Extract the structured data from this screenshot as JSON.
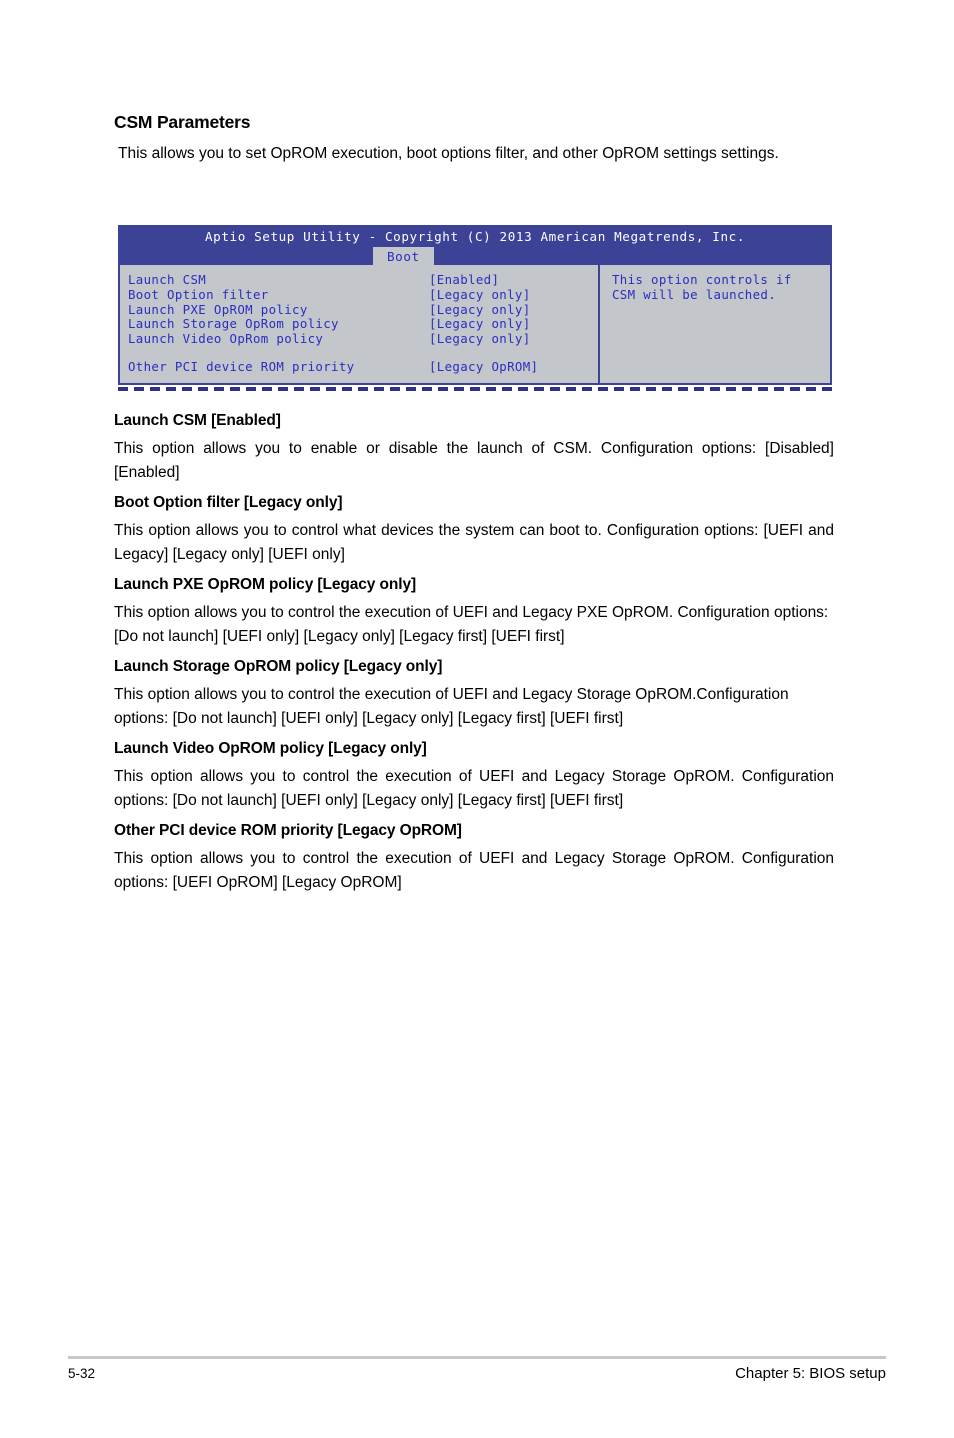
{
  "document": {
    "section_title": "CSM Parameters",
    "intro": "This allows you to set OpROM execution, boot options filter, and other OpROM settings settings.",
    "items": [
      {
        "title": "Launch CSM [Enabled]",
        "description": "This option allows you to enable or disable the launch of CSM. Configuration options: [Disabled] [Enabled]"
      },
      {
        "title": "Boot Option filter [Legacy only]",
        "description": "This option allows you to control what devices the system can boot to. Configuration options: [UEFI and Legacy] [Legacy only] [UEFI only]"
      },
      {
        "title": "Launch PXE OpROM policy [Legacy only]",
        "description": "This option allows you to control the execution of UEFI and Legacy PXE OpROM. Configuration options: [Do not launch] [UEFI only] [Legacy only] [Legacy first] [UEFI first]"
      },
      {
        "title": "Launch Storage OpROM policy [Legacy only]",
        "description": "This option allows you to control the execution of UEFI and Legacy Storage OpROM.Configuration options: [Do not launch] [UEFI only] [Legacy only] [Legacy first] [UEFI first]"
      },
      {
        "title": "Launch Video OpROM policy [Legacy only]",
        "description": "This option allows you to control the execution of UEFI and Legacy Storage OpROM. Configuration options: [Do not launch] [UEFI only] [Legacy only] [Legacy first] [UEFI first]"
      },
      {
        "title": "Other PCI device ROM priority [Legacy OpROM]",
        "description": "This option allows you to control the execution of UEFI and Legacy Storage OpROM. Configuration options: [UEFI OpROM] [Legacy OpROM]"
      }
    ]
  },
  "bios": {
    "title": "Aptio Setup Utility - Copyright (C) 2013 American Megatrends, Inc.",
    "active_tab": "Boot",
    "settings": [
      {
        "label": "Launch CSM",
        "value": "[Enabled]"
      },
      {
        "label": "Boot Option filter",
        "value": "[Legacy only]"
      },
      {
        "label": "Launch PXE OpROM policy",
        "value": "[Legacy only]"
      },
      {
        "label": "Launch Storage OpRom policy",
        "value": "[Legacy only]"
      },
      {
        "label": "Launch Video OpRom policy",
        "value": "[Legacy only]"
      },
      {
        "label": "Other PCI device ROM priority",
        "value": "[Legacy OpROM]"
      }
    ],
    "help": {
      "line1": "This option controls if",
      "line2": "CSM will be launched."
    },
    "colors": {
      "header_blue": "#3c4296",
      "body_gray": "#c3c6cb",
      "text_blue": "#2a2ec0",
      "header_text": "#ffffff"
    }
  },
  "footer": {
    "page_number": "5-32",
    "chapter": "Chapter 5: BIOS setup"
  }
}
